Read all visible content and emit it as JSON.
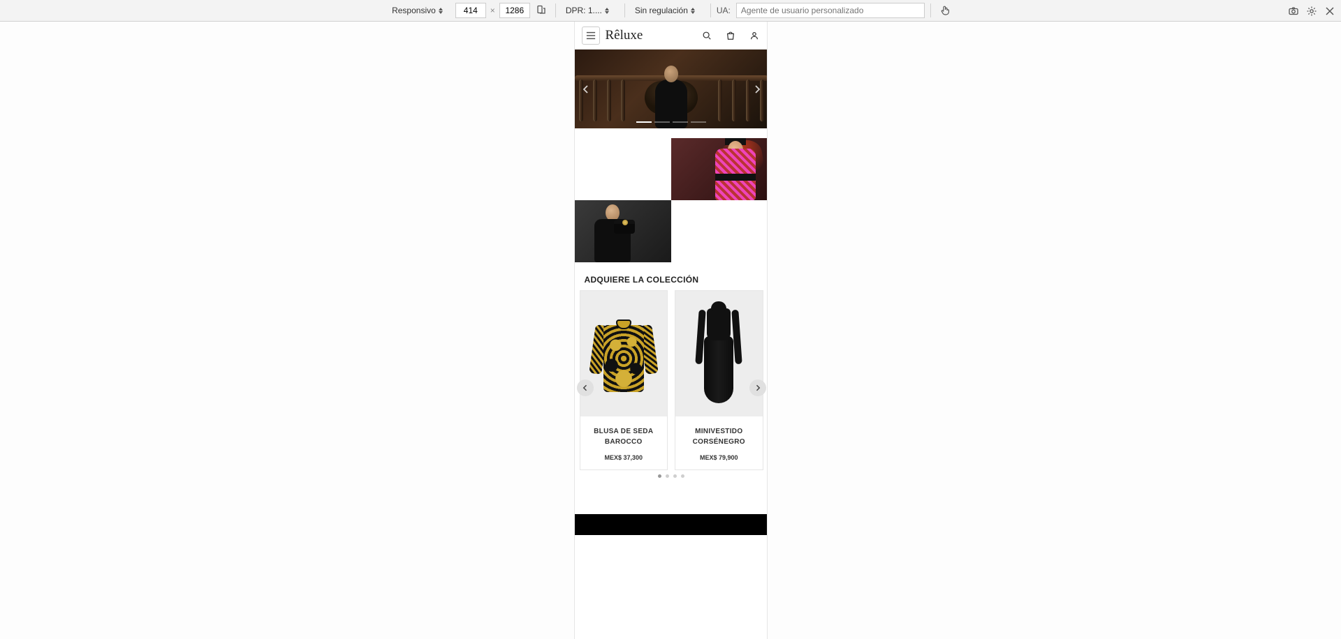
{
  "devtools": {
    "mode": "Responsivo",
    "width": "414",
    "height": "1286",
    "dpr_label": "DPR: 1....",
    "throttle": "Sin regulación",
    "ua_label": "UA:",
    "ua_placeholder": "Agente de usuario personalizado"
  },
  "site": {
    "brand": "Rêluxe"
  },
  "section": {
    "collection_title": "ADQUIERE LA COLECCIÓN"
  },
  "products": [
    {
      "name": "BLUSA DE SEDA\nBAROCCO",
      "price": "MEX$ 37,300"
    },
    {
      "name": "MINIVESTIDO\nCORSÉNEGRO",
      "price": "MEX$ 79,900"
    }
  ]
}
